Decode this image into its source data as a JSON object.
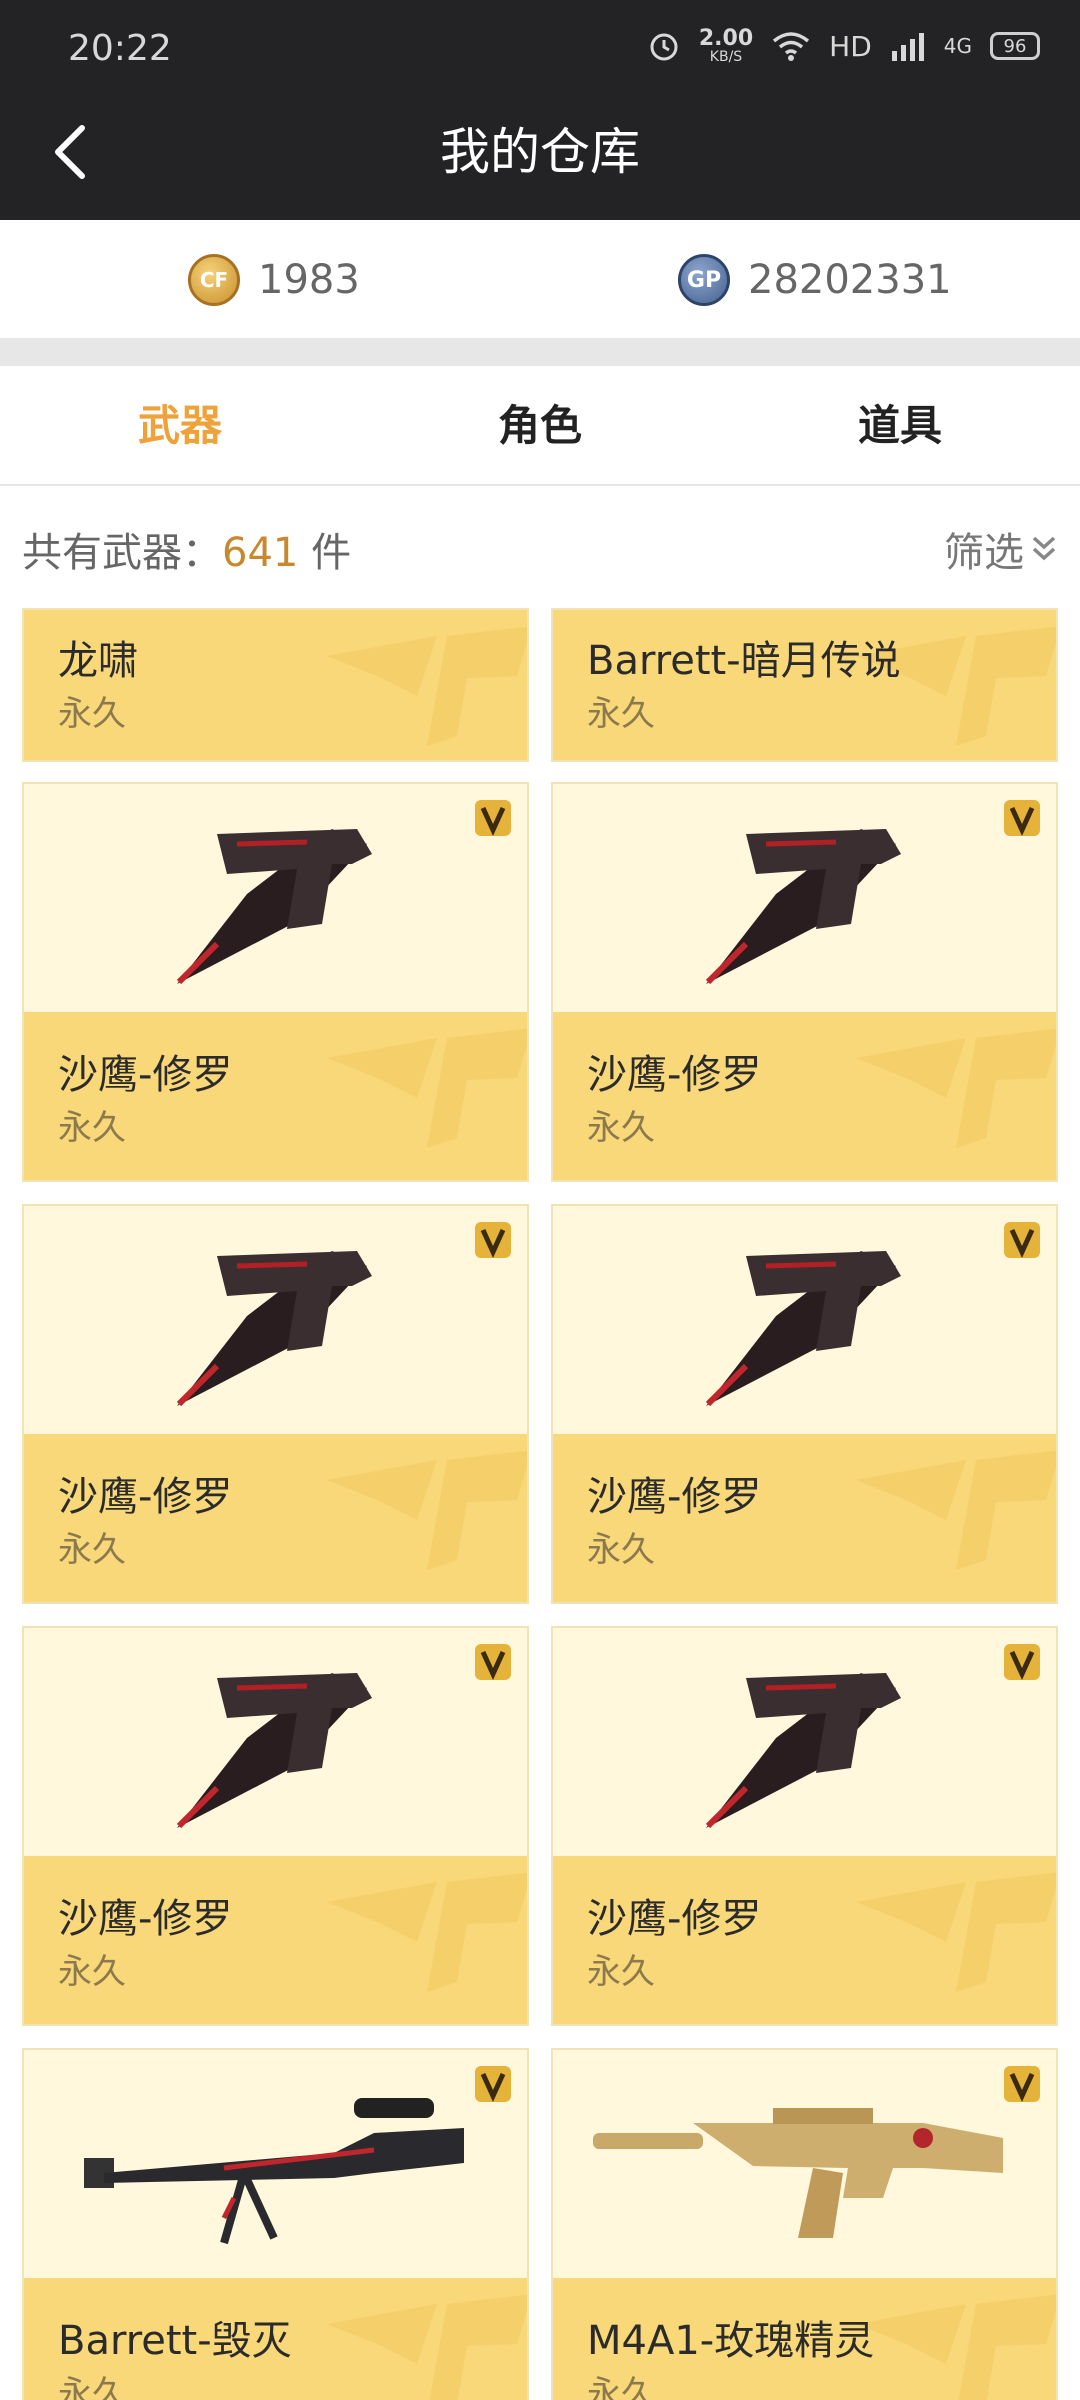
{
  "status_bar": {
    "time": "20:22",
    "speed_value": "2.00",
    "speed_unit": "KB/S",
    "hd_label": "HD",
    "network": "4G",
    "battery": "96",
    "icons": [
      "alarm-icon",
      "wifi-icon",
      "signal-icon"
    ]
  },
  "nav": {
    "title": "我的仓库",
    "back_icon": "chevron-left-icon"
  },
  "currency": {
    "cf": {
      "icon": "cf-coin-icon",
      "label": "CF",
      "value": "1983"
    },
    "gp": {
      "icon": "gp-coin-icon",
      "label": "GP",
      "value": "28202331"
    }
  },
  "tabs": [
    {
      "label": "武器",
      "active": true
    },
    {
      "label": "角色",
      "active": false
    },
    {
      "label": "道具",
      "active": false
    }
  ],
  "summary": {
    "prefix": "共有武器：",
    "count": "641",
    "suffix": " 件",
    "filter_label": "筛选",
    "filter_icon": "double-chevron-down-icon"
  },
  "items": [
    {
      "name": "龙啸",
      "duration": "永久",
      "image": "none"
    },
    {
      "name": "Barrett-暗月传说",
      "duration": "永久",
      "image": "none"
    },
    {
      "name": "沙鹰-修罗",
      "duration": "永久",
      "image": "pistol-icon",
      "vip": true
    },
    {
      "name": "沙鹰-修罗",
      "duration": "永久",
      "image": "pistol-icon",
      "vip": true
    },
    {
      "name": "沙鹰-修罗",
      "duration": "永久",
      "image": "pistol-icon",
      "vip": true
    },
    {
      "name": "沙鹰-修罗",
      "duration": "永久",
      "image": "pistol-icon",
      "vip": true
    },
    {
      "name": "沙鹰-修罗",
      "duration": "永久",
      "image": "pistol-icon",
      "vip": true
    },
    {
      "name": "沙鹰-修罗",
      "duration": "永久",
      "image": "pistol-icon",
      "vip": true
    },
    {
      "name": "Barrett-毁灭",
      "duration": "永久",
      "image": "sniper-rifle-icon",
      "vip": true
    },
    {
      "name": "M4A1-玫瑰精灵",
      "duration": "永久",
      "image": "assault-rifle-icon",
      "vip": true
    }
  ],
  "colors": {
    "nav_bg": "#232326",
    "tab_active": "#f0a23a",
    "card_top": "#fff8dd",
    "card_bottom": "#f9d87a",
    "count_color": "#c8892e"
  }
}
